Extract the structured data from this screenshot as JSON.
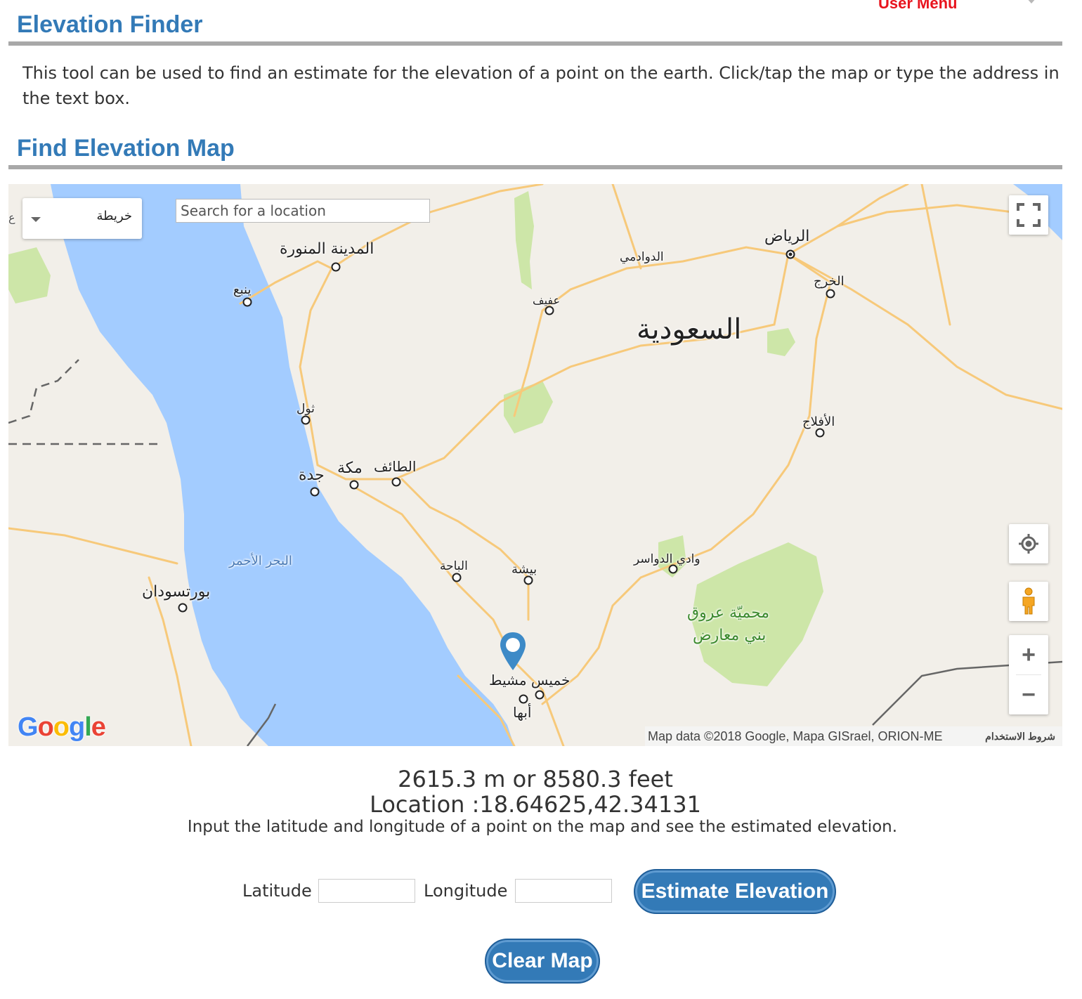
{
  "header": {
    "user_menu": "User Menu",
    "title": "Elevation Finder",
    "intro": "This tool can be used to find an estimate for the elevation of a point on the earth. Click/tap the map or type the address in the text box.",
    "map_section_title": "Find Elevation Map"
  },
  "map": {
    "type_selector": "خريطة",
    "type_edge_text": "ع",
    "search_placeholder": "Search for a location",
    "google_logo": "Google",
    "attribution": "Map data ©2018 Google, Mapa GISrael, ORION-ME",
    "terms": "شروط الاستخدام",
    "country_label": "السعودية",
    "sea_label": "البحر الأحمر",
    "reserve_label_1": "محميّة عروق",
    "reserve_label_2": "بني معارض",
    "cities": {
      "medina": "المدينة المنورة",
      "yanbu": "ينبع",
      "dawadmi": "الدوادمي",
      "afif": "عفيف",
      "riyadh": "الرياض",
      "kharj": "الخرج",
      "thuwal": "ثول",
      "aflaj": "الأفلاج",
      "jeddah": "جدة",
      "mecca": "مكة",
      "taif": "الطائف",
      "baha": "الباحة",
      "bisha": "بيشة",
      "wadi_dawasir": "وادي الدواسر",
      "port_sudan": "بورتسودان",
      "khamis": "خميس مشيط",
      "abha": "أبها"
    },
    "icons": {
      "fullscreen": "fullscreen-icon",
      "locate": "my-location-icon",
      "pegman": "pegman-icon",
      "marker": "map-pin-icon"
    },
    "colors": {
      "water": "#a3ccff",
      "land": "#f2efe9",
      "park": "#cde6a8",
      "road": "#f7c97a"
    }
  },
  "result": {
    "elevation": "2615.3 m or 8580.3 feet",
    "location": "Location :18.64625,42.34131",
    "hint": "Input the latitude and longitude of a point on the map and see the estimated elevation."
  },
  "form": {
    "latitude_label": "Latitude",
    "latitude_value": "",
    "longitude_label": "Longitude",
    "longitude_value": "",
    "estimate_button": "Estimate Elevation",
    "clear_button": "Clear Map"
  },
  "zoom": {
    "in": "+",
    "out": "−"
  }
}
